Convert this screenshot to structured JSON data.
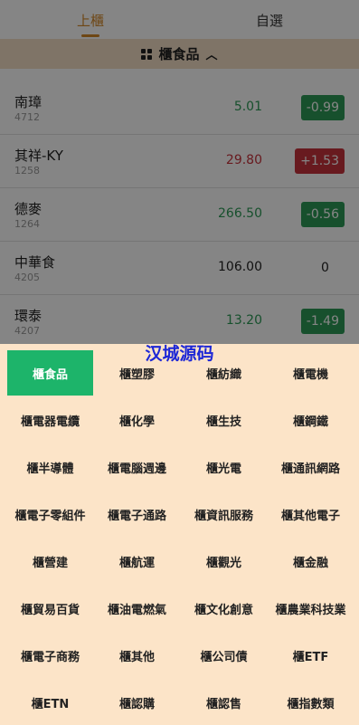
{
  "tabs": [
    {
      "label": "上櫃",
      "active": true
    },
    {
      "label": "自選",
      "active": false
    }
  ],
  "category_header": {
    "title": "櫃食品",
    "icon": "grid-icon",
    "toggle_icon": "chevron-up-icon"
  },
  "stocks": [
    {
      "name": "南璋",
      "code": "4712",
      "price": "5.01",
      "change": "-0.99",
      "direction": "down"
    },
    {
      "name": "其祥-KY",
      "code": "1258",
      "price": "29.80",
      "change": "+1.53",
      "direction": "up"
    },
    {
      "name": "德麥",
      "code": "1264",
      "price": "266.50",
      "change": "-0.56",
      "direction": "down"
    },
    {
      "name": "中華食",
      "code": "4205",
      "price": "106.00",
      "change": "0",
      "direction": "flat"
    },
    {
      "name": "環泰",
      "code": "4207",
      "price": "13.20",
      "change": "-1.49",
      "direction": "down"
    }
  ],
  "watermark": "汉城源码",
  "categories": [
    "櫃食品",
    "櫃塑膠",
    "櫃紡織",
    "櫃電機",
    "櫃電器電纜",
    "櫃化學",
    "櫃生技",
    "櫃鋼鐵",
    "櫃半導體",
    "櫃電腦週邊",
    "櫃光電",
    "櫃通訊網路",
    "櫃電子零組件",
    "櫃電子通路",
    "櫃資訊服務",
    "櫃其他電子",
    "櫃營建",
    "櫃航運",
    "櫃觀光",
    "櫃金融",
    "櫃貿易百貨",
    "櫃油電燃氣",
    "櫃文化創意",
    "櫃農業科技業",
    "櫃電子商務",
    "櫃其他",
    "櫃公司債",
    "櫃ETF",
    "櫃ETN",
    "櫃認購",
    "櫃認售",
    "櫃指數類"
  ],
  "selected_category": "櫃食品",
  "colors": {
    "accent": "#d4892a",
    "up": "#c8323c",
    "down": "#2c9a56",
    "selected": "#1db46a",
    "panel": "#fce4c8"
  }
}
